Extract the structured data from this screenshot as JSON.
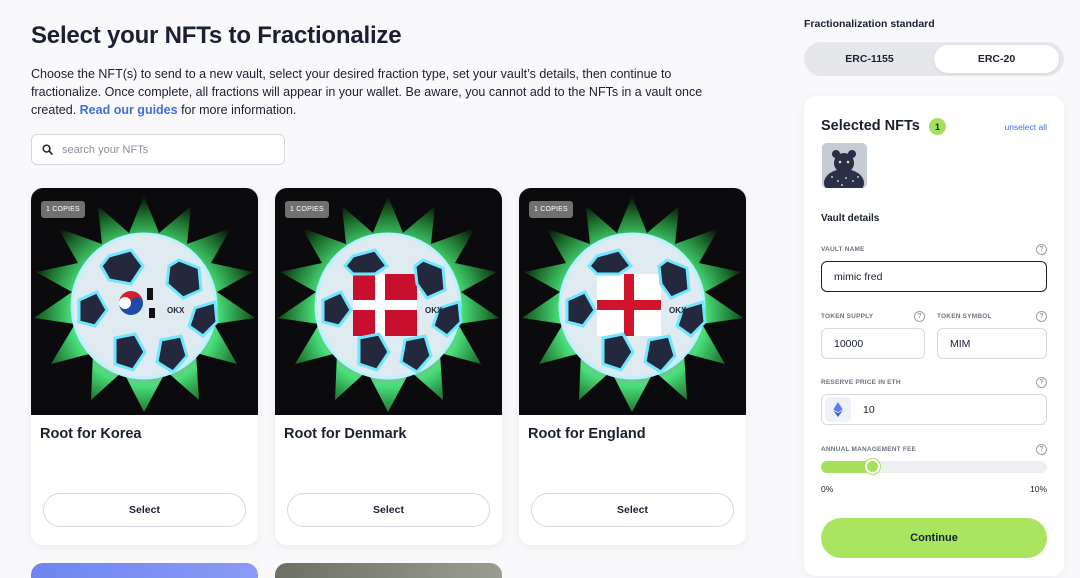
{
  "page": {
    "title": "Select your NFTs to Fractionalize",
    "description_text": "Choose the NFT(s) to send to a new vault, select your desired fraction type, set your vault’s details, then continue to fractionalize. Once complete, all fractions will appear in your wallet. Be aware, you cannot add to the NFTs in a vault once created.",
    "guides_link": "Read our guides",
    "description_tail": "for more information."
  },
  "search": {
    "placeholder": "search your NFTs",
    "value": ""
  },
  "nfts": [
    {
      "name": "Root for Korea",
      "copies": "1 COPIES",
      "select_label": "Select",
      "flag": "korea"
    },
    {
      "name": "Root for Denmark",
      "copies": "1 COPIES",
      "select_label": "Select",
      "flag": "denmark"
    },
    {
      "name": "Root for England",
      "copies": "1 COPIES",
      "select_label": "Select",
      "flag": "england"
    }
  ],
  "standard": {
    "label": "Fractionalization standard",
    "options": [
      "ERC-1155",
      "ERC-20"
    ],
    "selected": "ERC-20"
  },
  "selected_panel": {
    "title": "Selected NFTs",
    "count": "1",
    "unselect_all": "unselect all",
    "vault_details_heading": "Vault details",
    "vault_name_label": "VAULT NAME",
    "vault_name_value": "mimic fred",
    "token_supply_label": "TOKEN SUPPLY",
    "token_supply_value": "10000",
    "token_symbol_label": "TOKEN SYMBOL",
    "token_symbol_value": "MIM",
    "reserve_price_label": "RESERVE PRICE IN ETH",
    "reserve_price_value": "10",
    "fee_label": "ANNUAL MANAGEMENT FEE",
    "fee_min": "0%",
    "fee_max": "10%",
    "fee_value_fraction": 0.22,
    "help_glyph": "?",
    "continue_label": "Continue"
  },
  "colors": {
    "accent_green": "#a9e55f",
    "link_blue": "#3d6fe0",
    "text_dark": "#1a2033"
  }
}
